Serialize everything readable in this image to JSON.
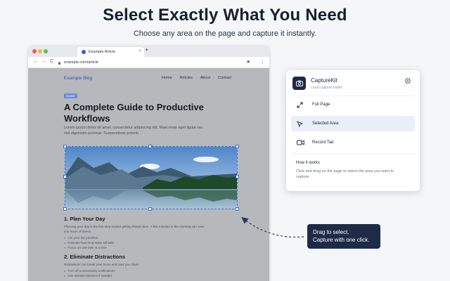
{
  "hero": {
    "title": "Select Exactly What You Need",
    "subtitle": "Choose any area on the page and capture it instantly."
  },
  "browser": {
    "tab_title": "Example Article",
    "tab_close": "×",
    "new_tab": "+",
    "url": "example.com/article",
    "nav": {
      "back": "←",
      "forward": "→",
      "reload": "C",
      "star": "★",
      "menu": "⋮"
    }
  },
  "site": {
    "brand": "Example Blog",
    "nav": [
      "Home",
      "Articles",
      "About",
      "Contact"
    ],
    "tag": "GUIDE",
    "title": "A Complete Guide to Productive Workflows",
    "lede": "Lorem ipsum dolor sit amet, consectetur adipiscing elit. Maecenas eget ligula nec nisl dignissim pulvinar. Suspendisse potenti.",
    "section1": {
      "heading": "1. Plan Your Day",
      "para": "Planning your day is the first step toward getting things done. A few minutes in the morning can save you hours of stress.",
      "bullets": [
        "List your top priorities",
        "Estimate how long tasks will take",
        "Focus on one task at a time"
      ]
    },
    "section2": {
      "heading": "2. Eliminate Distractions",
      "para": "Distractions can break your focus and slow you down.",
      "bullets": [
        "Turn off unnecessary notifications",
        "Use website blockers if needed"
      ]
    }
  },
  "panel": {
    "name": "CaptureKit",
    "tagline": "Local capture toolkit",
    "options": [
      {
        "label": "Full Page",
        "icon": "expand-icon",
        "selected": false
      },
      {
        "label": "Selected Area",
        "icon": "cursor-icon",
        "selected": true
      },
      {
        "label": "Record Tab",
        "icon": "video-icon",
        "selected": false
      }
    ],
    "how_title": "How it works",
    "how_text": "Click and drag on the page to select the area you want to capture."
  },
  "tooltip": {
    "line1": "Drag to select.",
    "line2": "Capture with one click."
  },
  "colors": {
    "accent": "#2f74e0",
    "navy": "#1e2b47",
    "selected_bg": "#e9eef8"
  }
}
